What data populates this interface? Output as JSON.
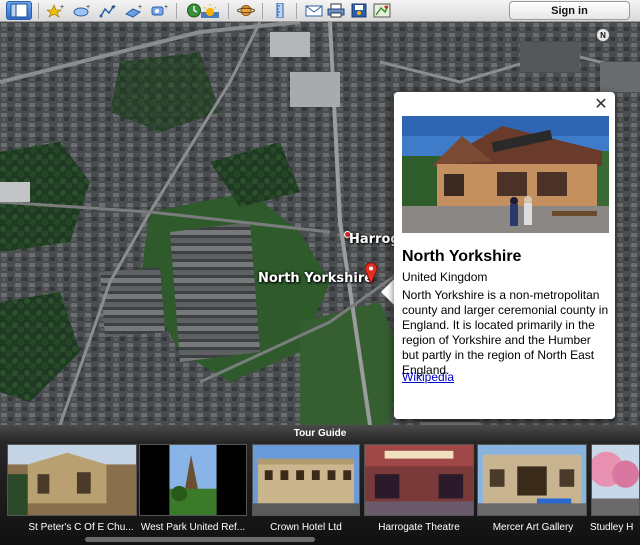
{
  "toolbar": {
    "buttons": [
      {
        "name": "sidebar-toggle-button",
        "icon": "sidebar-icon"
      },
      {
        "name": "add-placemark-button",
        "icon": "placemark-icon"
      },
      {
        "name": "add-polygon-button",
        "icon": "polygon-icon"
      },
      {
        "name": "add-path-button",
        "icon": "path-icon"
      },
      {
        "name": "add-image-overlay-button",
        "icon": "overlay-icon"
      },
      {
        "name": "record-tour-button",
        "icon": "record-tour-icon"
      },
      {
        "name": "historical-imagery-button",
        "icon": "clock-icon"
      },
      {
        "name": "sunlight-button",
        "icon": "sun-icon"
      },
      {
        "name": "planets-button",
        "icon": "planet-icon"
      },
      {
        "name": "ruler-button",
        "icon": "ruler-icon"
      },
      {
        "name": "email-button",
        "icon": "envelope-icon"
      },
      {
        "name": "print-button",
        "icon": "printer-icon"
      },
      {
        "name": "save-image-button",
        "icon": "image-icon"
      },
      {
        "name": "view-in-maps-button",
        "icon": "map-icon"
      }
    ],
    "signin_label": "Sign in"
  },
  "map": {
    "compass_label": "N",
    "labels": {
      "small_place": "Harrog",
      "main_place": "North Yorkshire"
    }
  },
  "balloon": {
    "close_label": "✕",
    "title": "North Yorkshire",
    "subtitle": "United Kingdom",
    "description": "North Yorkshire is a non-metropolitan county and larger ceremonial county in England. It is located primarily in the region of Yorkshire and the Humber but partly in the region of North East England.",
    "link_text": "Wikipedia"
  },
  "tour_guide": {
    "title": "Tour Guide",
    "items": [
      {
        "caption": "St Peter's C Of E Chu..."
      },
      {
        "caption": "West Park United Ref..."
      },
      {
        "caption": "Crown Hotel Ltd"
      },
      {
        "caption": "Harrogate Theatre"
      },
      {
        "caption": "Mercer Art Gallery"
      },
      {
        "caption": "Studley H"
      }
    ]
  }
}
